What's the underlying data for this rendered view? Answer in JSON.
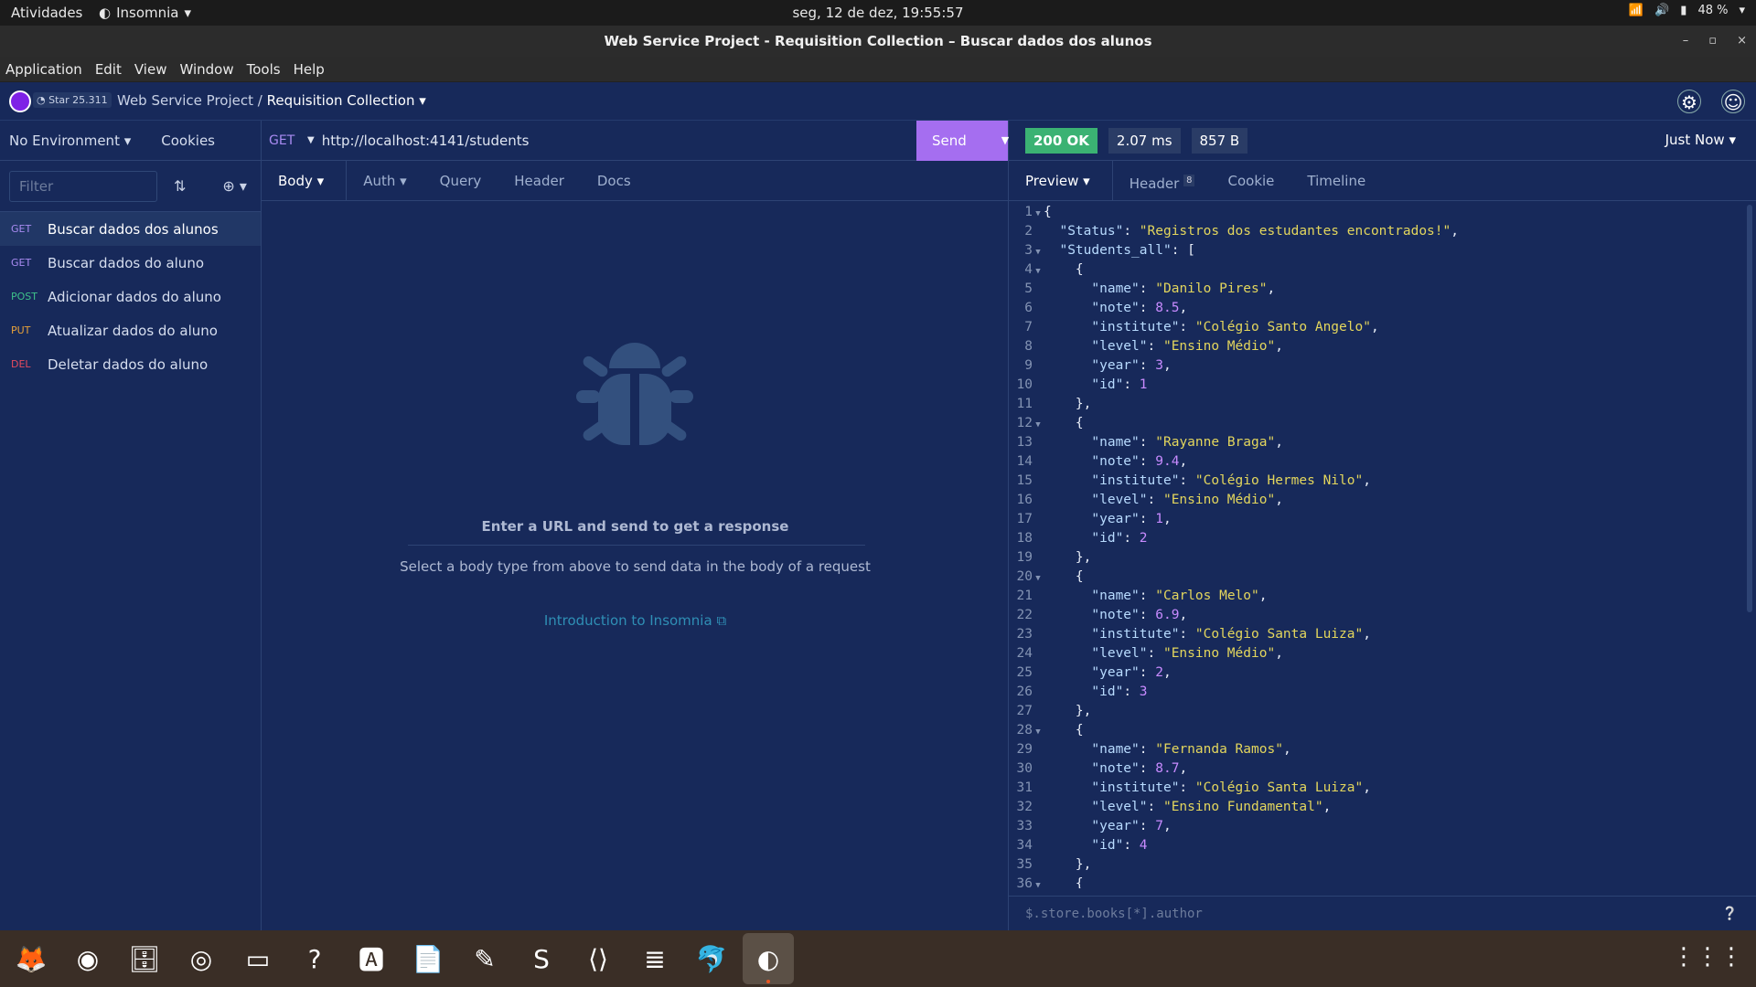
{
  "system": {
    "activities": "Atividades",
    "app_name": "Insomnia",
    "clock": "seg, 12 de dez, 19:55:57",
    "battery": "48 %"
  },
  "window": {
    "title": "Web Service Project - Requisition Collection – Buscar dados dos alunos"
  },
  "menu": [
    "Application",
    "Edit",
    "View",
    "Window",
    "Tools",
    "Help"
  ],
  "header": {
    "star_label": "Star",
    "star_count": "25.311",
    "project": "Web Service Project",
    "separator": "/",
    "collection": "Requisition Collection"
  },
  "sidebar": {
    "environment": "No Environment",
    "cookies": "Cookies",
    "filter_placeholder": "Filter",
    "requests": [
      {
        "method": "GET",
        "name": "Buscar dados dos alunos",
        "selected": true
      },
      {
        "method": "GET",
        "name": "Buscar dados do aluno"
      },
      {
        "method": "POST",
        "name": "Adicionar dados do aluno"
      },
      {
        "method": "PUT",
        "name": "Atualizar dados do aluno"
      },
      {
        "method": "DEL",
        "name": "Deletar dados do aluno"
      }
    ]
  },
  "request": {
    "method": "GET",
    "url": "http://localhost:4141/students",
    "send": "Send",
    "tabs": [
      "Body",
      "Auth",
      "Query",
      "Header",
      "Docs"
    ],
    "empty_title": "Enter a URL and send to get a response",
    "empty_hint": "Select a body type from above to send data in the body of a request",
    "intro_link": "Introduction to Insomnia"
  },
  "response": {
    "status": "200 OK",
    "time": "2.07 ms",
    "size": "857 B",
    "when": "Just Now",
    "tabs": [
      "Preview",
      "Header",
      "Cookie",
      "Timeline"
    ],
    "header_count": "8",
    "filter_placeholder": "$.store.books[*].author",
    "lines": [
      "{",
      "  \"Status\": \"Registros dos estudantes encontrados!\",",
      "  \"Students_all\": [",
      "    {",
      "      \"name\": \"Danilo Pires\",",
      "      \"note\": 8.5,",
      "      \"institute\": \"Colégio Santo Angelo\",",
      "      \"level\": \"Ensino Médio\",",
      "      \"year\": 3,",
      "      \"id\": 1",
      "    },",
      "    {",
      "      \"name\": \"Rayanne Braga\",",
      "      \"note\": 9.4,",
      "      \"institute\": \"Colégio Hermes Nilo\",",
      "      \"level\": \"Ensino Médio\",",
      "      \"year\": 1,",
      "      \"id\": 2",
      "    },",
      "    {",
      "      \"name\": \"Carlos Melo\",",
      "      \"note\": 6.9,",
      "      \"institute\": \"Colégio Santa Luiza\",",
      "      \"level\": \"Ensino Médio\",",
      "      \"year\": 2,",
      "      \"id\": 3",
      "    },",
      "    {",
      "      \"name\": \"Fernanda Ramos\",",
      "      \"note\": 8.7,",
      "      \"institute\": \"Colégio Santa Luiza\",",
      "      \"level\": \"Ensino Fundamental\",",
      "      \"year\": 7,",
      "      \"id\": 4",
      "    },",
      "    {"
    ],
    "fold_lines": [
      1,
      3,
      4,
      12,
      20,
      28,
      36
    ]
  },
  "dock": [
    {
      "name": "firefox-icon",
      "glyph": "🦊"
    },
    {
      "name": "chrome-icon",
      "glyph": "◉"
    },
    {
      "name": "files-icon",
      "glyph": "🗄"
    },
    {
      "name": "rhythmbox-icon",
      "glyph": "◎"
    },
    {
      "name": "terminal-icon",
      "glyph": "▭"
    },
    {
      "name": "help-icon",
      "glyph": "?"
    },
    {
      "name": "software-icon",
      "glyph": "🅰"
    },
    {
      "name": "writer-icon",
      "glyph": "📄"
    },
    {
      "name": "reader-icon",
      "glyph": "✎"
    },
    {
      "name": "sublime-icon",
      "glyph": "S"
    },
    {
      "name": "vscode-icon",
      "glyph": "⟨⟩"
    },
    {
      "name": "database-icon",
      "glyph": "≣"
    },
    {
      "name": "mysql-workbench-icon",
      "glyph": "🐬"
    },
    {
      "name": "insomnia-icon",
      "glyph": "◐",
      "active": true
    }
  ]
}
